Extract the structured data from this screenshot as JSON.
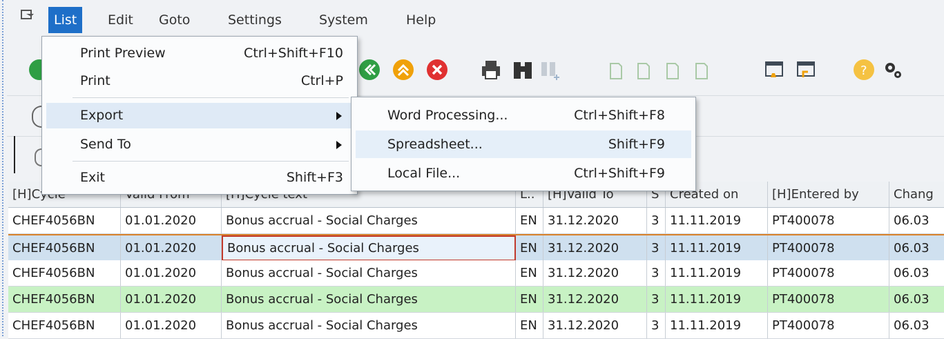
{
  "menubar": {
    "items": [
      {
        "label": "List"
      },
      {
        "label": "Edit"
      },
      {
        "label": "Goto"
      },
      {
        "label": "Settings"
      },
      {
        "label": "System"
      },
      {
        "label": "Help"
      }
    ]
  },
  "list_menu": {
    "items": [
      {
        "label": "Print Preview",
        "shortcut": "Ctrl+Shift+F10"
      },
      {
        "label": "Print",
        "shortcut": "Ctrl+P"
      },
      {
        "label": "Export",
        "shortcut": ""
      },
      {
        "label": "Send To",
        "shortcut": ""
      },
      {
        "label": "Exit",
        "shortcut": "Shift+F3"
      }
    ]
  },
  "export_submenu": {
    "items": [
      {
        "label": "Word Processing...",
        "shortcut": "Ctrl+Shift+F8"
      },
      {
        "label": "Spreadsheet...",
        "shortcut": "Shift+F9"
      },
      {
        "label": "Local File...",
        "shortcut": "Ctrl+Shift+F9"
      }
    ]
  },
  "table": {
    "headers": [
      "[H]Cycle",
      "Valid From",
      "[H]Cycle text",
      "L..",
      "[H]Valid To",
      "S",
      "Created on",
      "[H]Entered by",
      "Chang"
    ],
    "rows": [
      [
        "CHEF4056BN",
        "01.01.2020",
        "Bonus accrual - Social Charges",
        "EN",
        "31.12.2020",
        "3",
        "11.11.2019",
        "PT400078",
        "06.03"
      ],
      [
        "CHEF4056BN",
        "01.01.2020",
        "Bonus accrual - Social Charges",
        "EN",
        "31.12.2020",
        "3",
        "11.11.2019",
        "PT400078",
        "06.03"
      ],
      [
        "CHEF4056BN",
        "01.01.2020",
        "Bonus accrual - Social Charges",
        "EN",
        "31.12.2020",
        "3",
        "11.11.2019",
        "PT400078",
        "06.03"
      ],
      [
        "CHEF4056BN",
        "01.01.2020",
        "Bonus accrual - Social Charges",
        "EN",
        "31.12.2020",
        "3",
        "11.11.2019",
        "PT400078",
        "06.03"
      ],
      [
        "CHEF4056BN",
        "01.01.2020",
        "Bonus accrual - Social Charges",
        "EN",
        "31.12.2020",
        "3",
        "11.11.2019",
        "PT400078",
        "06.03"
      ]
    ]
  },
  "colors": {
    "menu_active": "#1e6fc8",
    "row_selected": "#cfe0ef",
    "row_green": "#c8f2c4",
    "row_white": "#ffffff",
    "focus_cell": "#c0392b"
  }
}
